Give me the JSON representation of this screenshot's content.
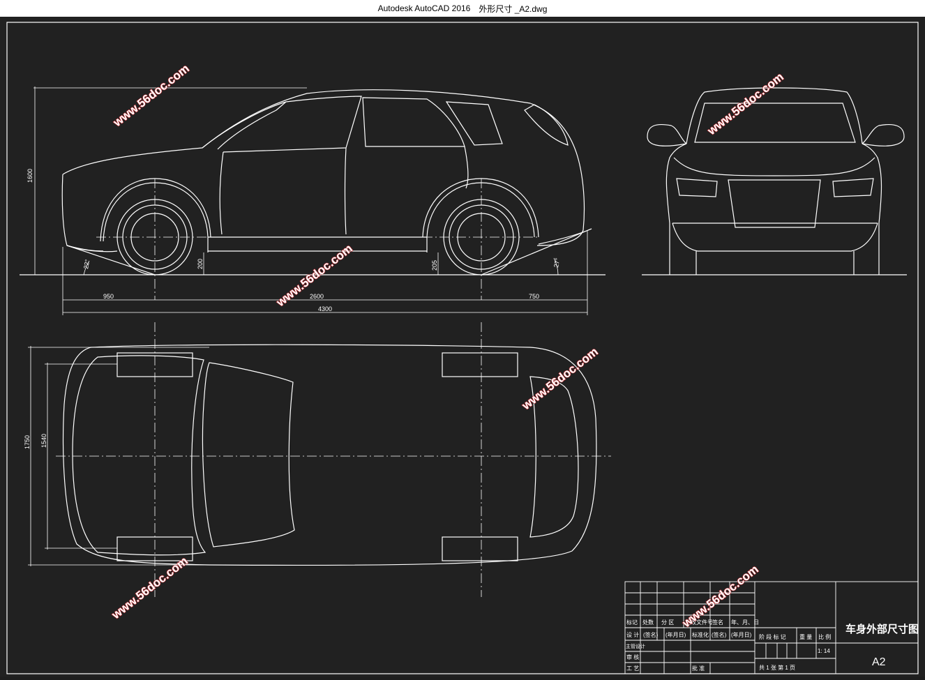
{
  "window": {
    "app_title": "Autodesk AutoCAD 2016",
    "file_title": "外形尺寸 _A2.dwg"
  },
  "dimensions": {
    "height": "1600",
    "front_overhang": "950",
    "wheelbase": "2600",
    "rear_overhang": "750",
    "length": "4300",
    "approach_angle": "22°",
    "departure_angle": "27°",
    "front_clearance": "200",
    "rear_clearance": "205",
    "width": "1750",
    "track": "1540"
  },
  "watermark": "www.56doc.com",
  "title_block": {
    "drawing_title": "车身外部尺寸图",
    "sheet_size": "A2",
    "scale": "1: 14",
    "header_row": [
      "标记",
      "处数",
      "分 区",
      "更改文件号",
      "签名",
      "年、月、日"
    ],
    "design_row": [
      "设 计",
      "(签名)",
      "(年月日)",
      "标准化",
      "(签名)",
      "(年月日)"
    ],
    "right_header": [
      "阶 段 标 记",
      "重 量",
      "比 例"
    ],
    "review_label": "审 核",
    "process_label": "工 艺",
    "approve_label": "批 准",
    "chief_label": "主管设计",
    "sheet_info": "共 1 张    第 1 页"
  }
}
